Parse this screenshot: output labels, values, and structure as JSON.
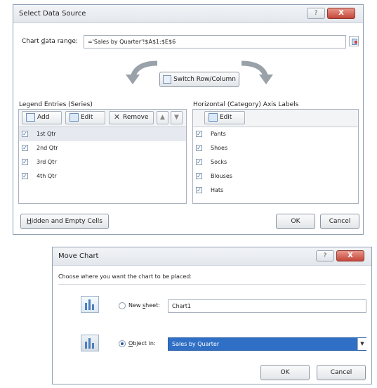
{
  "select_data_source": {
    "title": "Select Data Source",
    "help_glyph": "?",
    "close_glyph": "X",
    "chart_range_label": "Chart data range:",
    "chart_range_value": "='Sales by Quarter'!$A$1:$E$6",
    "switch_button": "Switch Row/Column",
    "legend_label": "Legend Entries (Series)",
    "legend_add": "Add",
    "legend_edit": "Edit",
    "legend_remove": "Remove",
    "series": [
      {
        "label": "1st Qtr",
        "checked": true
      },
      {
        "label": "2nd Qtr",
        "checked": true
      },
      {
        "label": "3rd Qtr",
        "checked": true
      },
      {
        "label": "4th Qtr",
        "checked": true
      }
    ],
    "axis_label": "Horizontal (Category) Axis Labels",
    "axis_edit": "Edit",
    "categories": [
      {
        "label": "Pants",
        "checked": true
      },
      {
        "label": "Shoes",
        "checked": true
      },
      {
        "label": "Socks",
        "checked": true
      },
      {
        "label": "Blouses",
        "checked": true
      },
      {
        "label": "Hats",
        "checked": true
      }
    ],
    "hidden_cells_button": "Hidden and Empty Cells",
    "ok": "OK",
    "cancel": "Cancel"
  },
  "move_chart": {
    "title": "Move Chart",
    "help_glyph": "?",
    "close_glyph": "X",
    "prompt": "Choose where you want the chart to be placed:",
    "new_sheet_label": "New sheet:",
    "new_sheet_value": "Chart1",
    "object_in_label": "Object in:",
    "object_in_value": "Sales by Quarter",
    "ok": "OK",
    "cancel": "Cancel"
  },
  "colors": {
    "accent": "#2c6fbe",
    "selection": "#2f6fc5",
    "close": "#c4463a"
  }
}
